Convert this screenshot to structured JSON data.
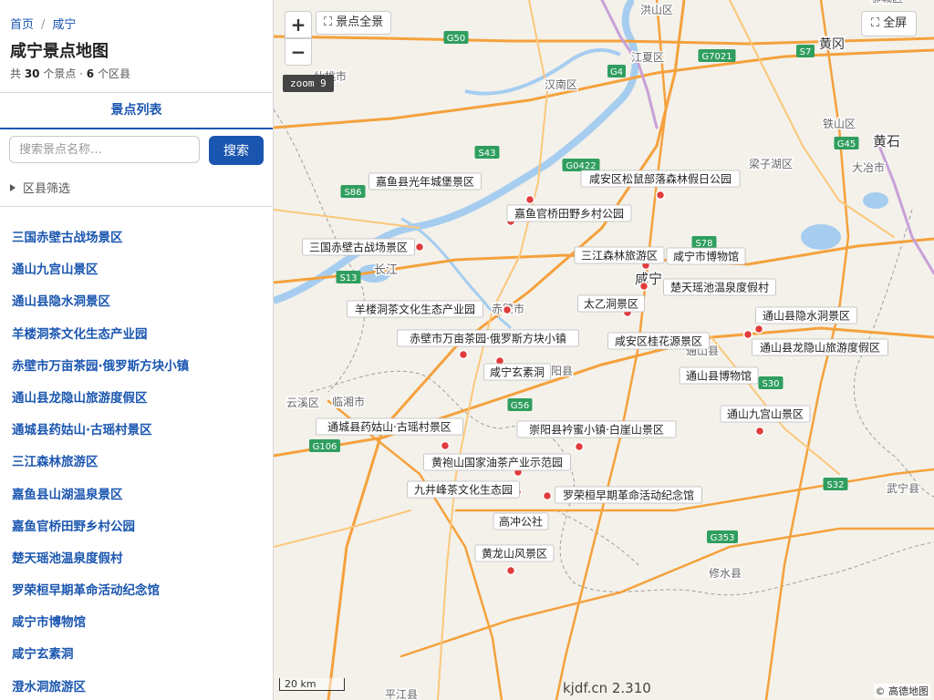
{
  "breadcrumb": {
    "home": "首页",
    "current": "咸宁"
  },
  "page_title": "咸宁景点地图",
  "stats": {
    "prefix": "共 ",
    "spots": "30",
    "mid": " 个景点 · ",
    "districts": "6",
    "suffix": " 个区县"
  },
  "tab": {
    "label": "景点列表"
  },
  "search": {
    "placeholder": "搜索景点名称…",
    "button": "搜索"
  },
  "filter": {
    "label": "区县筛选"
  },
  "list": [
    "三国赤壁古战场景区",
    "通山九宫山景区",
    "通山县隐水洞景区",
    "羊楼洞茶文化生态产业园",
    "赤壁市万亩茶园·俄罗斯方块小镇",
    "通山县龙隐山旅游度假区",
    "通城县药姑山·古瑶村景区",
    "三江森林旅游区",
    "嘉鱼县山湖温泉景区",
    "嘉鱼官桥田野乡村公园",
    "楚天瑶池温泉度假村",
    "罗荣桓早期革命活动纪念馆",
    "咸宁市博物馆",
    "咸宁玄素洞",
    "澄水洞旅游区"
  ],
  "map_controls": {
    "zoom_in": "+",
    "zoom_out": "−",
    "scenic": "⛶ 景点全景",
    "fullscreen": "⛶ 全屏",
    "zoom_level": "zoom 9",
    "scale": "20 km"
  },
  "watermark": "kjdf.cn 2.310",
  "copyright": "© 高德地图",
  "colors": {
    "accent": "#1a56b0",
    "marker": "#e23b3b",
    "road": "#f5a13c",
    "water": "#a6cdf0"
  },
  "chart_data": {
    "type": "scatter",
    "title": "",
    "points": [
      {
        "name": "嘉鱼县光年城堡景区"
      },
      {
        "name": "咸安区松鼠部落森林假日公园"
      },
      {
        "name": "嘉鱼官桥田野乡村公园"
      },
      {
        "name": "三国赤壁古战场景区"
      },
      {
        "name": "三江森林旅游区"
      },
      {
        "name": "咸宁市博物馆"
      },
      {
        "name": "楚天瑶池温泉度假村"
      },
      {
        "name": "羊楼洞茶文化生态产业园"
      },
      {
        "name": "太乙洞景区"
      },
      {
        "name": "通山县隐水洞景区"
      },
      {
        "name": "赤壁市万亩茶园·俄罗斯方块小镇"
      },
      {
        "name": "咸安区桂花源景区"
      },
      {
        "name": "通山县龙隐山旅游度假区"
      },
      {
        "name": "咸宁玄素洞"
      },
      {
        "name": "通山县博物馆"
      },
      {
        "name": "通山九宫山景区"
      },
      {
        "name": "通城县药姑山·古瑶村景区"
      },
      {
        "name": "崇阳县衿蜜小镇·白崖山景区"
      },
      {
        "name": "黄袍山国家油茶产业示范园"
      },
      {
        "name": "九井峰茶文化生态园"
      },
      {
        "name": "罗荣桓早期革命活动纪念馆"
      },
      {
        "name": "高冲公社"
      },
      {
        "name": "黄龙山风景区"
      }
    ],
    "place_labels": [
      "仙桃市",
      "汉南区",
      "江夏区",
      "洪山区",
      "黄冈",
      "黄石",
      "铁山区",
      "梁子湖区",
      "大冶市",
      "长江",
      "赤壁市",
      "崇阳县",
      "咸宁",
      "通山县",
      "云溪区",
      "临湘市",
      "武宁县",
      "修水县",
      "平江县",
      "鄂城区"
    ],
    "road_labels": [
      "G50",
      "G4",
      "G7021",
      "S7",
      "G45",
      "S43",
      "G0422",
      "S86",
      "S78",
      "S13",
      "G56",
      "G106",
      "S30",
      "S32",
      "G353"
    ]
  }
}
